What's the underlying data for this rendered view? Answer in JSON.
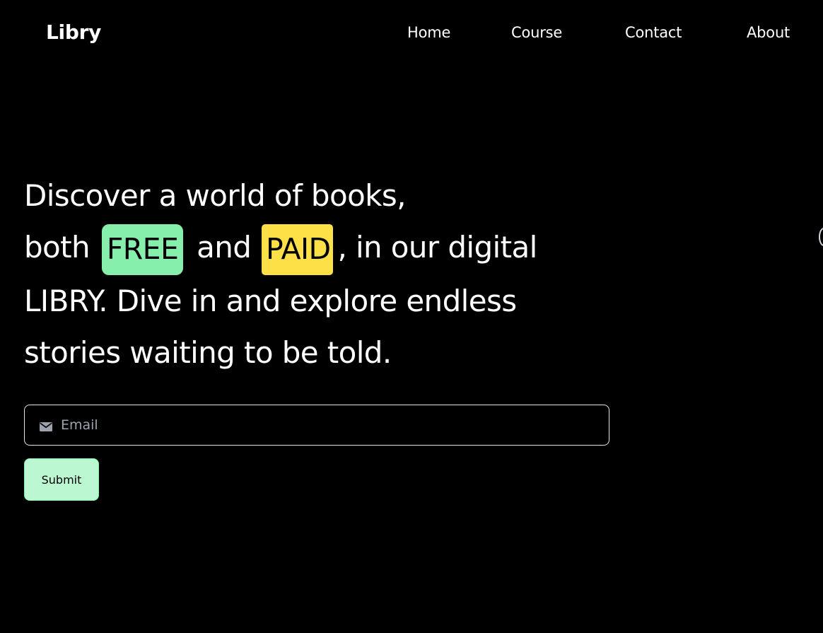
{
  "navbar": {
    "logo": "Libry",
    "links": [
      {
        "label": "Home"
      },
      {
        "label": "Course"
      },
      {
        "label": "Contact"
      },
      {
        "label": "About"
      }
    ]
  },
  "hero": {
    "line1": "Discover a world of books,",
    "line2_prefix": "both",
    "badge_free": "FREE",
    "line2_middle": "and",
    "badge_paid": "PAID",
    "line2_suffix": ", in our digital",
    "line3": "LIBRY. Dive in and explore endless",
    "line4": "stories waiting to be told."
  },
  "form": {
    "email_placeholder": "Email",
    "email_value": "",
    "submit_label": "Submit",
    "email_icon": "envelope-icon"
  },
  "colors": {
    "background": "#000000",
    "text": "#ffffff",
    "free_badge": "#86efac",
    "paid_badge": "#fde047",
    "submit_bg": "#bbf7d0",
    "input_border": "#e5e5e5",
    "placeholder": "#9ca3af"
  }
}
